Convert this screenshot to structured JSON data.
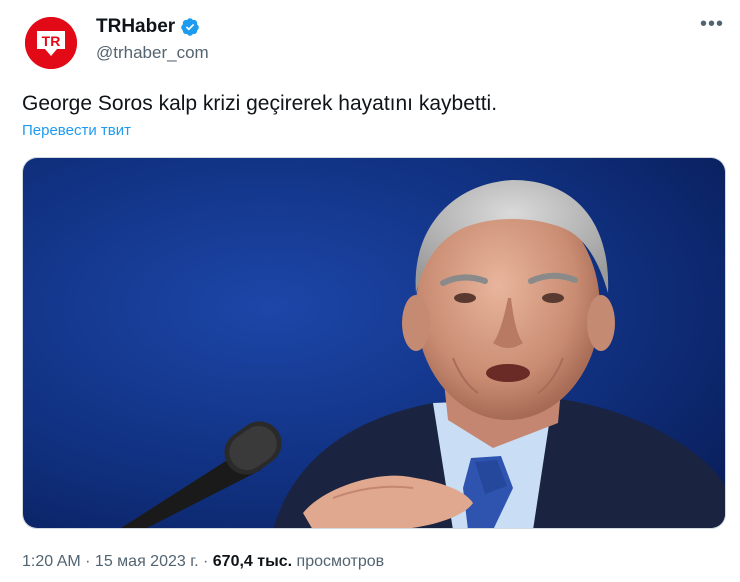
{
  "author": {
    "name": "TRHaber",
    "handle": "@trhaber_com",
    "avatar_text": "TR",
    "avatar_color": "#e30a17",
    "verified_color": "#1d9bf0"
  },
  "tweet": {
    "text": "George Soros kalp krizi geçirerek hayatını kaybetti.",
    "translate_label": "Перевести твит"
  },
  "media": {
    "icon": "photo-of-elderly-man-speaking-at-microphone"
  },
  "meta": {
    "time": "1:20 AM",
    "sep1": " · ",
    "date": "15 мая 2023 г.",
    "sep2": " · ",
    "views_count": "670,4 тыс.",
    "views_label": " просмотров"
  },
  "more_icon": "more-icon",
  "colors": {
    "text_primary": "#0f1419",
    "text_secondary": "#536471",
    "link": "#1d9bf0",
    "media_background": "#0d2d7a"
  }
}
